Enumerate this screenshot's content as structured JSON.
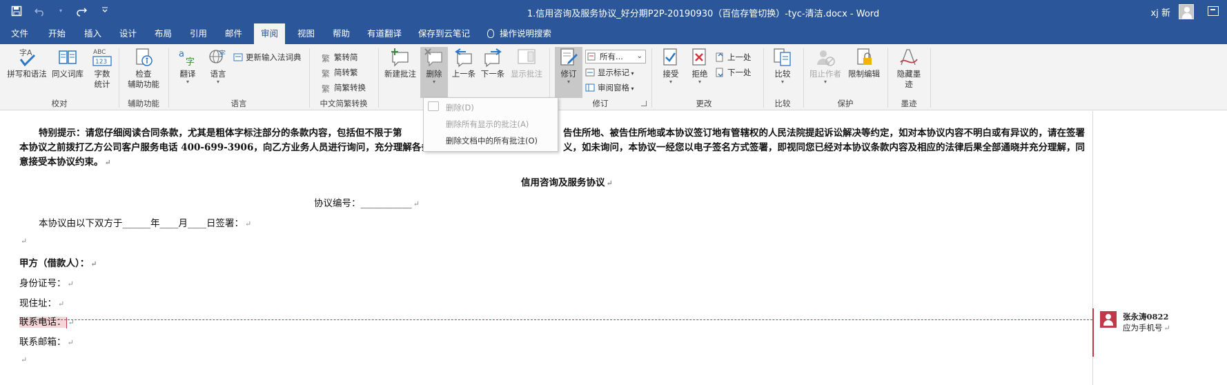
{
  "window": {
    "title": "1.信用咨询及服务协议_好分期P2P-20190930（百信存管切换）-tyc-清洁.docx  -  Word",
    "user": "xj 新",
    "colors": {
      "titlebar": "#2b579a",
      "ribbon": "#f3f3f3",
      "comment": "#c0394b"
    }
  },
  "qat": {
    "save_icon": "save-icon",
    "undo_icon": "undo-icon",
    "redo_icon": "redo-icon",
    "customize_icon": "customize-qat-icon"
  },
  "tabs": [
    {
      "label": "文件"
    },
    {
      "label": "开始"
    },
    {
      "label": "插入"
    },
    {
      "label": "设计"
    },
    {
      "label": "布局"
    },
    {
      "label": "引用"
    },
    {
      "label": "邮件"
    },
    {
      "label": "审阅",
      "active": true
    },
    {
      "label": "视图"
    },
    {
      "label": "帮助"
    },
    {
      "label": "有道翻译"
    },
    {
      "label": "保存到云笔记"
    },
    {
      "label": "操作说明搜索"
    }
  ],
  "ribbon": {
    "proofing": {
      "label": "校对",
      "spelling": "拼写和语法",
      "thesaurus": "同义词库",
      "wordcount_1": "字数",
      "wordcount_2": "统计"
    },
    "accessibility": {
      "label": "辅助功能",
      "check_1": "检查",
      "check_2": "辅助功能"
    },
    "language": {
      "label": "语言",
      "translate": "翻译",
      "language": "语言",
      "update_ime": "更新输入法词典"
    },
    "chinese": {
      "label": "中文简繁转换",
      "to_simplified": "繁转简",
      "to_traditional": "简转繁",
      "convert": "简繁转换"
    },
    "comments": {
      "new": "新建批注",
      "delete": "删除",
      "previous": "上一条",
      "next": "下一条",
      "show": "显示批注"
    },
    "tracking": {
      "label": "修订",
      "track": "修订",
      "markup_select": "所有...",
      "show_markup": "显示标记",
      "review_pane": "审阅窗格"
    },
    "changes": {
      "label": "更改",
      "accept": "接受",
      "reject": "拒绝",
      "previous": "上一处",
      "next": "下一处"
    },
    "compare": {
      "label": "比较",
      "compare": "比较"
    },
    "protect": {
      "label": "保护",
      "block_authors": "阻止作者",
      "restrict": "限制编辑"
    },
    "ink": {
      "label": "墨迹",
      "hide_1": "隐藏墨",
      "hide_2": "迹"
    }
  },
  "delete_menu": {
    "items": [
      "删除(D)",
      "删除所有显示的批注(A)",
      "删除文档中的所有批注(O)"
    ]
  },
  "document": {
    "notice_1": "特别提示：请您仔细阅读合同条款，尤其是粗体字标注部分的条款内容，包括但不限于第",
    "notice_1b": "告住所地、被告住所地或本协议签订地有管辖权的人民法院提起诉讼解决等约定，如对本协议内容不明白或有异议的，请在签署",
    "notice_2": "本协议之前拨打乙方公司客户服务电话 400-699-3906，向乙方业务人员进行询问，充分理解各条",
    "notice_2b": "义，如未询问，本协议一经您以电子签名方式签署，即视同您已经对本协议条款内容及相应的法律后果全部通晓并充分理解，同",
    "notice_3": "意接受本协议约束。",
    "doc_title": "信用咨询及服务协议",
    "agreement_no": "协议编号：___________",
    "signing": "本协议由以下双方于______年____月____日签署：",
    "party_a": "甲方（借款人）：",
    "id_no": "身份证号：",
    "address": "现住址：",
    "phone": "联系电话：",
    "email": "联系邮箱：",
    "para_mark": "↵"
  },
  "comment": {
    "author": "张永涛0822",
    "text": "应为手机号"
  }
}
